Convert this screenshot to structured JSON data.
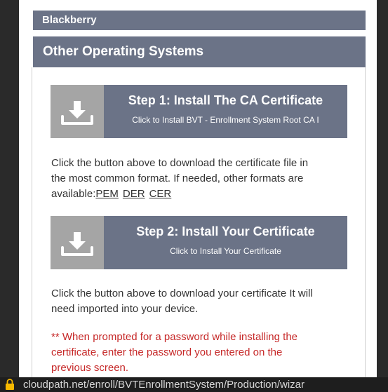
{
  "sections": {
    "blackberry": "Blackberry",
    "other_os": "Other Operating Systems"
  },
  "step1": {
    "title": "Step 1: Install The CA Certificate",
    "subtitle": "Click to Install BVT - Enrollment System Root CA I",
    "icon": "download-icon"
  },
  "para1": {
    "line1": "Click the button above to download the certificate file in",
    "line2": "the most common format. If needed, other formats are",
    "line3_prefix": "available:"
  },
  "formats": [
    "PEM",
    "DER",
    "CER"
  ],
  "step2": {
    "title": "Step 2: Install Your Certificate",
    "subtitle": "Click to Install Your Certificate",
    "icon": "download-icon"
  },
  "para2": {
    "line1": "Click the button above to download your certificate It will",
    "line2": "need imported into your device."
  },
  "warning": {
    "line1": "** When prompted for a password while installing the",
    "line2": "certificate, enter the password you entered on the",
    "line3": "previous screen."
  },
  "address_bar": {
    "url": "cloudpath.net/enroll/BVTEnrollmentSystem/Production/wizar",
    "icon": "lock-icon"
  },
  "colors": {
    "bar": "#6b7387",
    "icon_bg": "#a5a5a5",
    "warning": "#c62828"
  }
}
